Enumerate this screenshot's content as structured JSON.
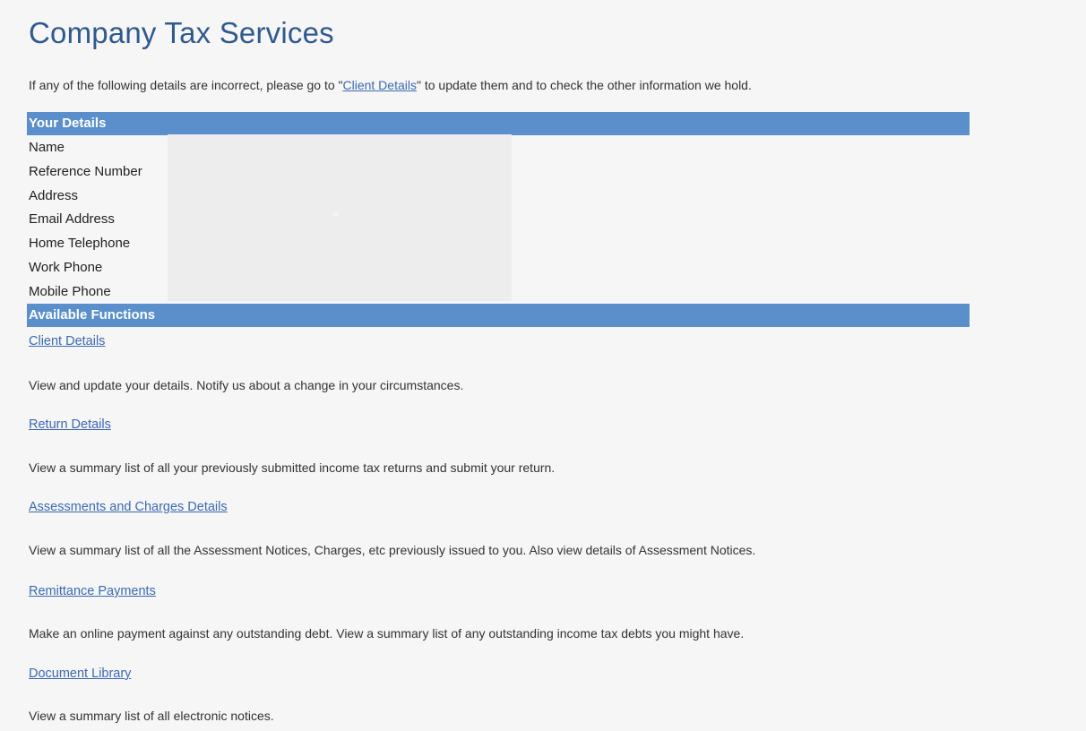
{
  "page": {
    "title": "Company Tax Services"
  },
  "intro": {
    "before": "If any of the following details are incorrect, please go to \"",
    "link": "Client Details",
    "after": "\" to update them and to check the other information we hold."
  },
  "your_details": {
    "header": "Your Details",
    "fields": [
      {
        "label": "Name"
      },
      {
        "label": "Reference Number"
      },
      {
        "label": "Address"
      },
      {
        "label": "Email Address"
      },
      {
        "label": "Home Telephone"
      },
      {
        "label": "Work Phone"
      },
      {
        "label": "Mobile Phone"
      }
    ]
  },
  "available_functions": {
    "header": "Available Functions",
    "items": [
      {
        "link": "Client Details",
        "description": "View and update your details. Notify us about a change in your circumstances."
      },
      {
        "link": "Return Details",
        "description": "View a summary list of all your previously submitted income tax returns and submit your return."
      },
      {
        "link": "Assessments and Charges Details",
        "description": "View a summary list of all the Assessment Notices, Charges, etc previously issued to you. Also view details of Assessment Notices."
      },
      {
        "link": "Remittance Payments",
        "description": "Make an online payment against any outstanding debt. View a summary list of any outstanding income tax debts you might have."
      },
      {
        "link": "Document Library",
        "description": "View a summary list of all electronic notices."
      }
    ]
  },
  "colors": {
    "title": "#2f5a8f",
    "section_bar": "#5b8fcc",
    "link": "#3a6ab3",
    "background": "#f6f6f6"
  }
}
